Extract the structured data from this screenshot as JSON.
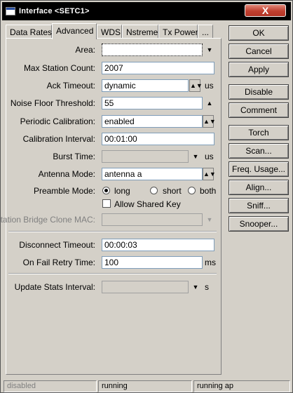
{
  "window": {
    "title": "Interface <SETC1>",
    "close_glyph": "X"
  },
  "tabs": [
    "Data Rates",
    "Advanced",
    "WDS",
    "Nstreme",
    "Tx Power",
    "..."
  ],
  "form": {
    "area_label": "Area:",
    "area_value": "",
    "max_station_label": "Max Station Count:",
    "max_station_value": "2007",
    "ack_label": "Ack Timeout:",
    "ack_value": "dynamic",
    "ack_unit": "us",
    "noise_label": "Noise Floor Threshold:",
    "noise_value": "55",
    "periodic_label": "Periodic Calibration:",
    "periodic_value": "enabled",
    "calib_interval_label": "Calibration Interval:",
    "calib_interval_value": "00:01:00",
    "burst_label": "Burst Time:",
    "burst_unit": "us",
    "antenna_label": "Antenna Mode:",
    "antenna_value": "antenna a",
    "preamble_label": "Preamble Mode:",
    "preamble_options": [
      "long",
      "short",
      "both"
    ],
    "preamble_selected": "long",
    "allow_shared_key": "Allow Shared Key",
    "bridge_clone_label": "Station Bridge Clone MAC:",
    "disconnect_label": "Disconnect Timeout:",
    "disconnect_value": "00:00:03",
    "fail_retry_label": "On Fail Retry Time:",
    "fail_retry_value": "100",
    "fail_retry_unit": "ms",
    "stats_label": "Update Stats Interval:",
    "stats_unit": "s"
  },
  "buttons": [
    "OK",
    "Cancel",
    "Apply",
    "Disable",
    "Comment",
    "Torch",
    "Scan...",
    "Freq. Usage...",
    "Align...",
    "Sniff...",
    "Snooper..."
  ],
  "status": [
    "disabled",
    "running",
    "running ap"
  ]
}
